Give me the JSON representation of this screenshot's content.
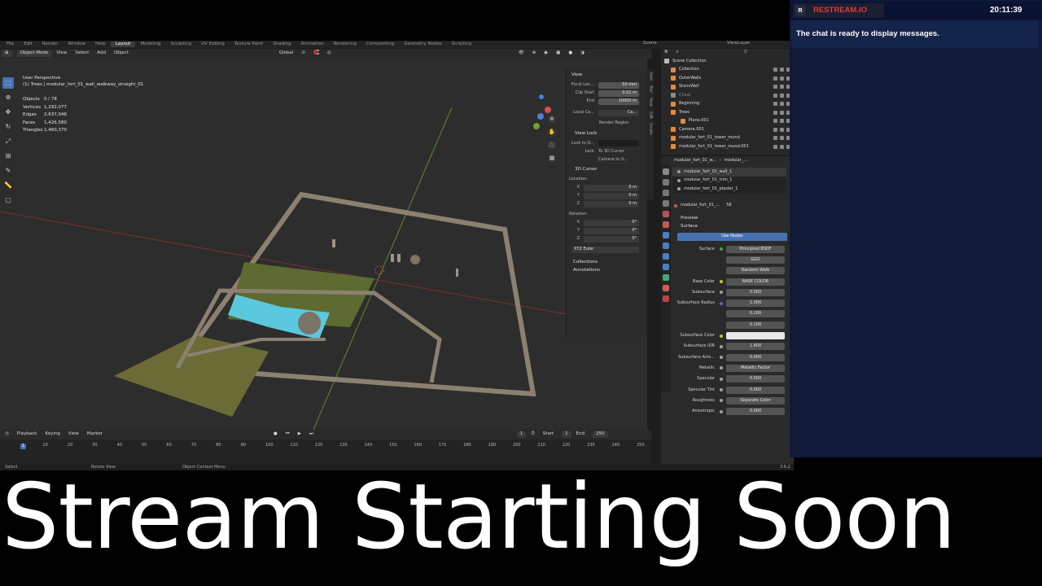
{
  "workspace_tabs": [
    "File",
    "Edit",
    "Render",
    "Window",
    "Help",
    "Layout",
    "Modeling",
    "Sculpting",
    "UV Editing",
    "Texture Paint",
    "Shading",
    "Animation",
    "Rendering",
    "Compositing",
    "Geometry Nodes",
    "Scripting"
  ],
  "workspace_active_index": 5,
  "scene_label": "Scene",
  "viewlayer_label": "ViewLayer",
  "header": {
    "mode": "Object Mode",
    "menus": [
      "View",
      "Select",
      "Add",
      "Object"
    ],
    "orientation": "Global",
    "options": "Options"
  },
  "viewport": {
    "perspective": "User Perspective",
    "object_path": "(1) Trees | modular_fort_01_wall_walkway_straight_01",
    "stats": [
      {
        "label": "Objects",
        "value": "0 / 78"
      },
      {
        "label": "Vertices",
        "value": "1,292,077"
      },
      {
        "label": "Edges",
        "value": "2,637,046"
      },
      {
        "label": "Faces",
        "value": "1,426,580"
      },
      {
        "label": "Triangles",
        "value": "1,460,370"
      }
    ]
  },
  "npanel": {
    "view_title": "View",
    "focal_label": "Focal Len...",
    "focal_value": "50 mm",
    "clip_start_label": "Clip Start",
    "clip_start_value": "0.01 m",
    "clip_end_label": "End",
    "clip_end_value": "10000 m",
    "local_camera_label": "Local Ca...",
    "local_camera_value": "Ca...",
    "render_region": "Render Region",
    "view_lock_title": "View Lock",
    "lock_to_object": "Lock to O...",
    "lock_label": "Lock",
    "lock_to_cursor": "To 3D Cursor",
    "camera_to_view": "Camera to V...",
    "cursor_title": "3D Cursor",
    "location_label": "Location:",
    "loc": [
      {
        "k": "X",
        "v": "0 m"
      },
      {
        "k": "Y",
        "v": "0 m"
      },
      {
        "k": "Z",
        "v": "0 m"
      }
    ],
    "rotation_label": "Rotation:",
    "rot": [
      {
        "k": "X",
        "v": "0°"
      },
      {
        "k": "Y",
        "v": "0°"
      },
      {
        "k": "Z",
        "v": "0°"
      }
    ],
    "rot_mode": "XYZ Euler",
    "collections": "Collections",
    "annotations": "Annotations",
    "side_tabs": [
      "Item",
      "Tool",
      "View",
      "Edit",
      "Create"
    ]
  },
  "timeline": {
    "menus": [
      "Playback",
      "Keying",
      "View",
      "Marker"
    ],
    "current_frame": "1",
    "start_label": "Start",
    "start": "1",
    "end_label": "End",
    "end": "250",
    "ticks": [
      "1",
      "10",
      "20",
      "30",
      "40",
      "50",
      "60",
      "70",
      "80",
      "90",
      "100",
      "110",
      "120",
      "130",
      "140",
      "150",
      "160",
      "170",
      "180",
      "190",
      "200",
      "210",
      "220",
      "230",
      "240",
      "250"
    ]
  },
  "statusbar": {
    "items": [
      "Select",
      "Rotate View",
      "Object Context Menu"
    ],
    "version": "3.6.2"
  },
  "outliner": {
    "root": "Scene Collection",
    "items": [
      {
        "label": "Collection",
        "color": "#e58a3c"
      },
      {
        "label": "OuterWalls",
        "color": "#e58a3c"
      },
      {
        "label": "StairsWell",
        "color": "#e58a3c"
      },
      {
        "label": "Chest",
        "color": "#8a8a8a"
      },
      {
        "label": "Beginning",
        "color": "#e58a3c"
      },
      {
        "label": "Trees",
        "color": "#e58a3c"
      },
      {
        "label": "Plane.001",
        "color": "#e58a3c"
      },
      {
        "label": "Camera.001",
        "color": "#e58a3c"
      },
      {
        "label": "modular_fort_01_tower_round",
        "color": "#e58a3c"
      },
      {
        "label": "modular_fort_01_tower_round.001",
        "color": "#e58a3c"
      }
    ]
  },
  "properties": {
    "breadcrumb_obj": "modular_fort_01_w...",
    "breadcrumb_mat": "modular_...",
    "materials": [
      "modular_fort_01_wall_1",
      "modular_fort_01_trim_1",
      "modular_fort_01_plaster_1"
    ],
    "mat_name": "modular_fort_01_...",
    "mat_users": "58",
    "preview": "Preview",
    "surface_section": "Surface",
    "use_nodes": "Use Nodes",
    "rows": [
      {
        "k": "Surface",
        "v": "Principled BSDF",
        "dot": "#3ea83e"
      },
      {
        "k": "",
        "v": "GGX",
        "dot": ""
      },
      {
        "k": "",
        "v": "Random Walk",
        "dot": ""
      },
      {
        "k": "Base Color",
        "v": "BASE COLOR",
        "dot": "#c7c729"
      },
      {
        "k": "Subsurface",
        "v": "0.000",
        "dot": "#a1a1a1"
      },
      {
        "k": "Subsurface Radius",
        "v": "1.000",
        "dot": "#6363c7"
      },
      {
        "k": "",
        "v": "0.200",
        "dot": ""
      },
      {
        "k": "",
        "v": "0.100",
        "dot": ""
      },
      {
        "k": "Subsurface Color",
        "v": "",
        "dot": "#c7c729"
      },
      {
        "k": "Subsurface IOR",
        "v": "1.400",
        "dot": "#a1a1a1"
      },
      {
        "k": "Subsurface Anis...",
        "v": "0.000",
        "dot": "#a1a1a1"
      },
      {
        "k": "Metallic",
        "v": "Metallic Factor",
        "dot": "#a1a1a1"
      },
      {
        "k": "Specular",
        "v": "0.500",
        "dot": "#a1a1a1"
      },
      {
        "k": "Specular Tint",
        "v": "0.000",
        "dot": "#a1a1a1"
      },
      {
        "k": "Roughness",
        "v": "Separate Color",
        "dot": "#a1a1a1"
      },
      {
        "k": "Anisotropic",
        "v": "0.000",
        "dot": "#a1a1a1"
      }
    ]
  },
  "chat": {
    "brand": "RESTREAM.IO",
    "time": "20:11:39",
    "message": "The chat is ready to display messages."
  },
  "overlay_title": "Stream Starting Soon",
  "colors": {
    "accent_blue": "#4772b3",
    "chat_bg": "#0e1a38",
    "restream_red": "#e8382f"
  }
}
